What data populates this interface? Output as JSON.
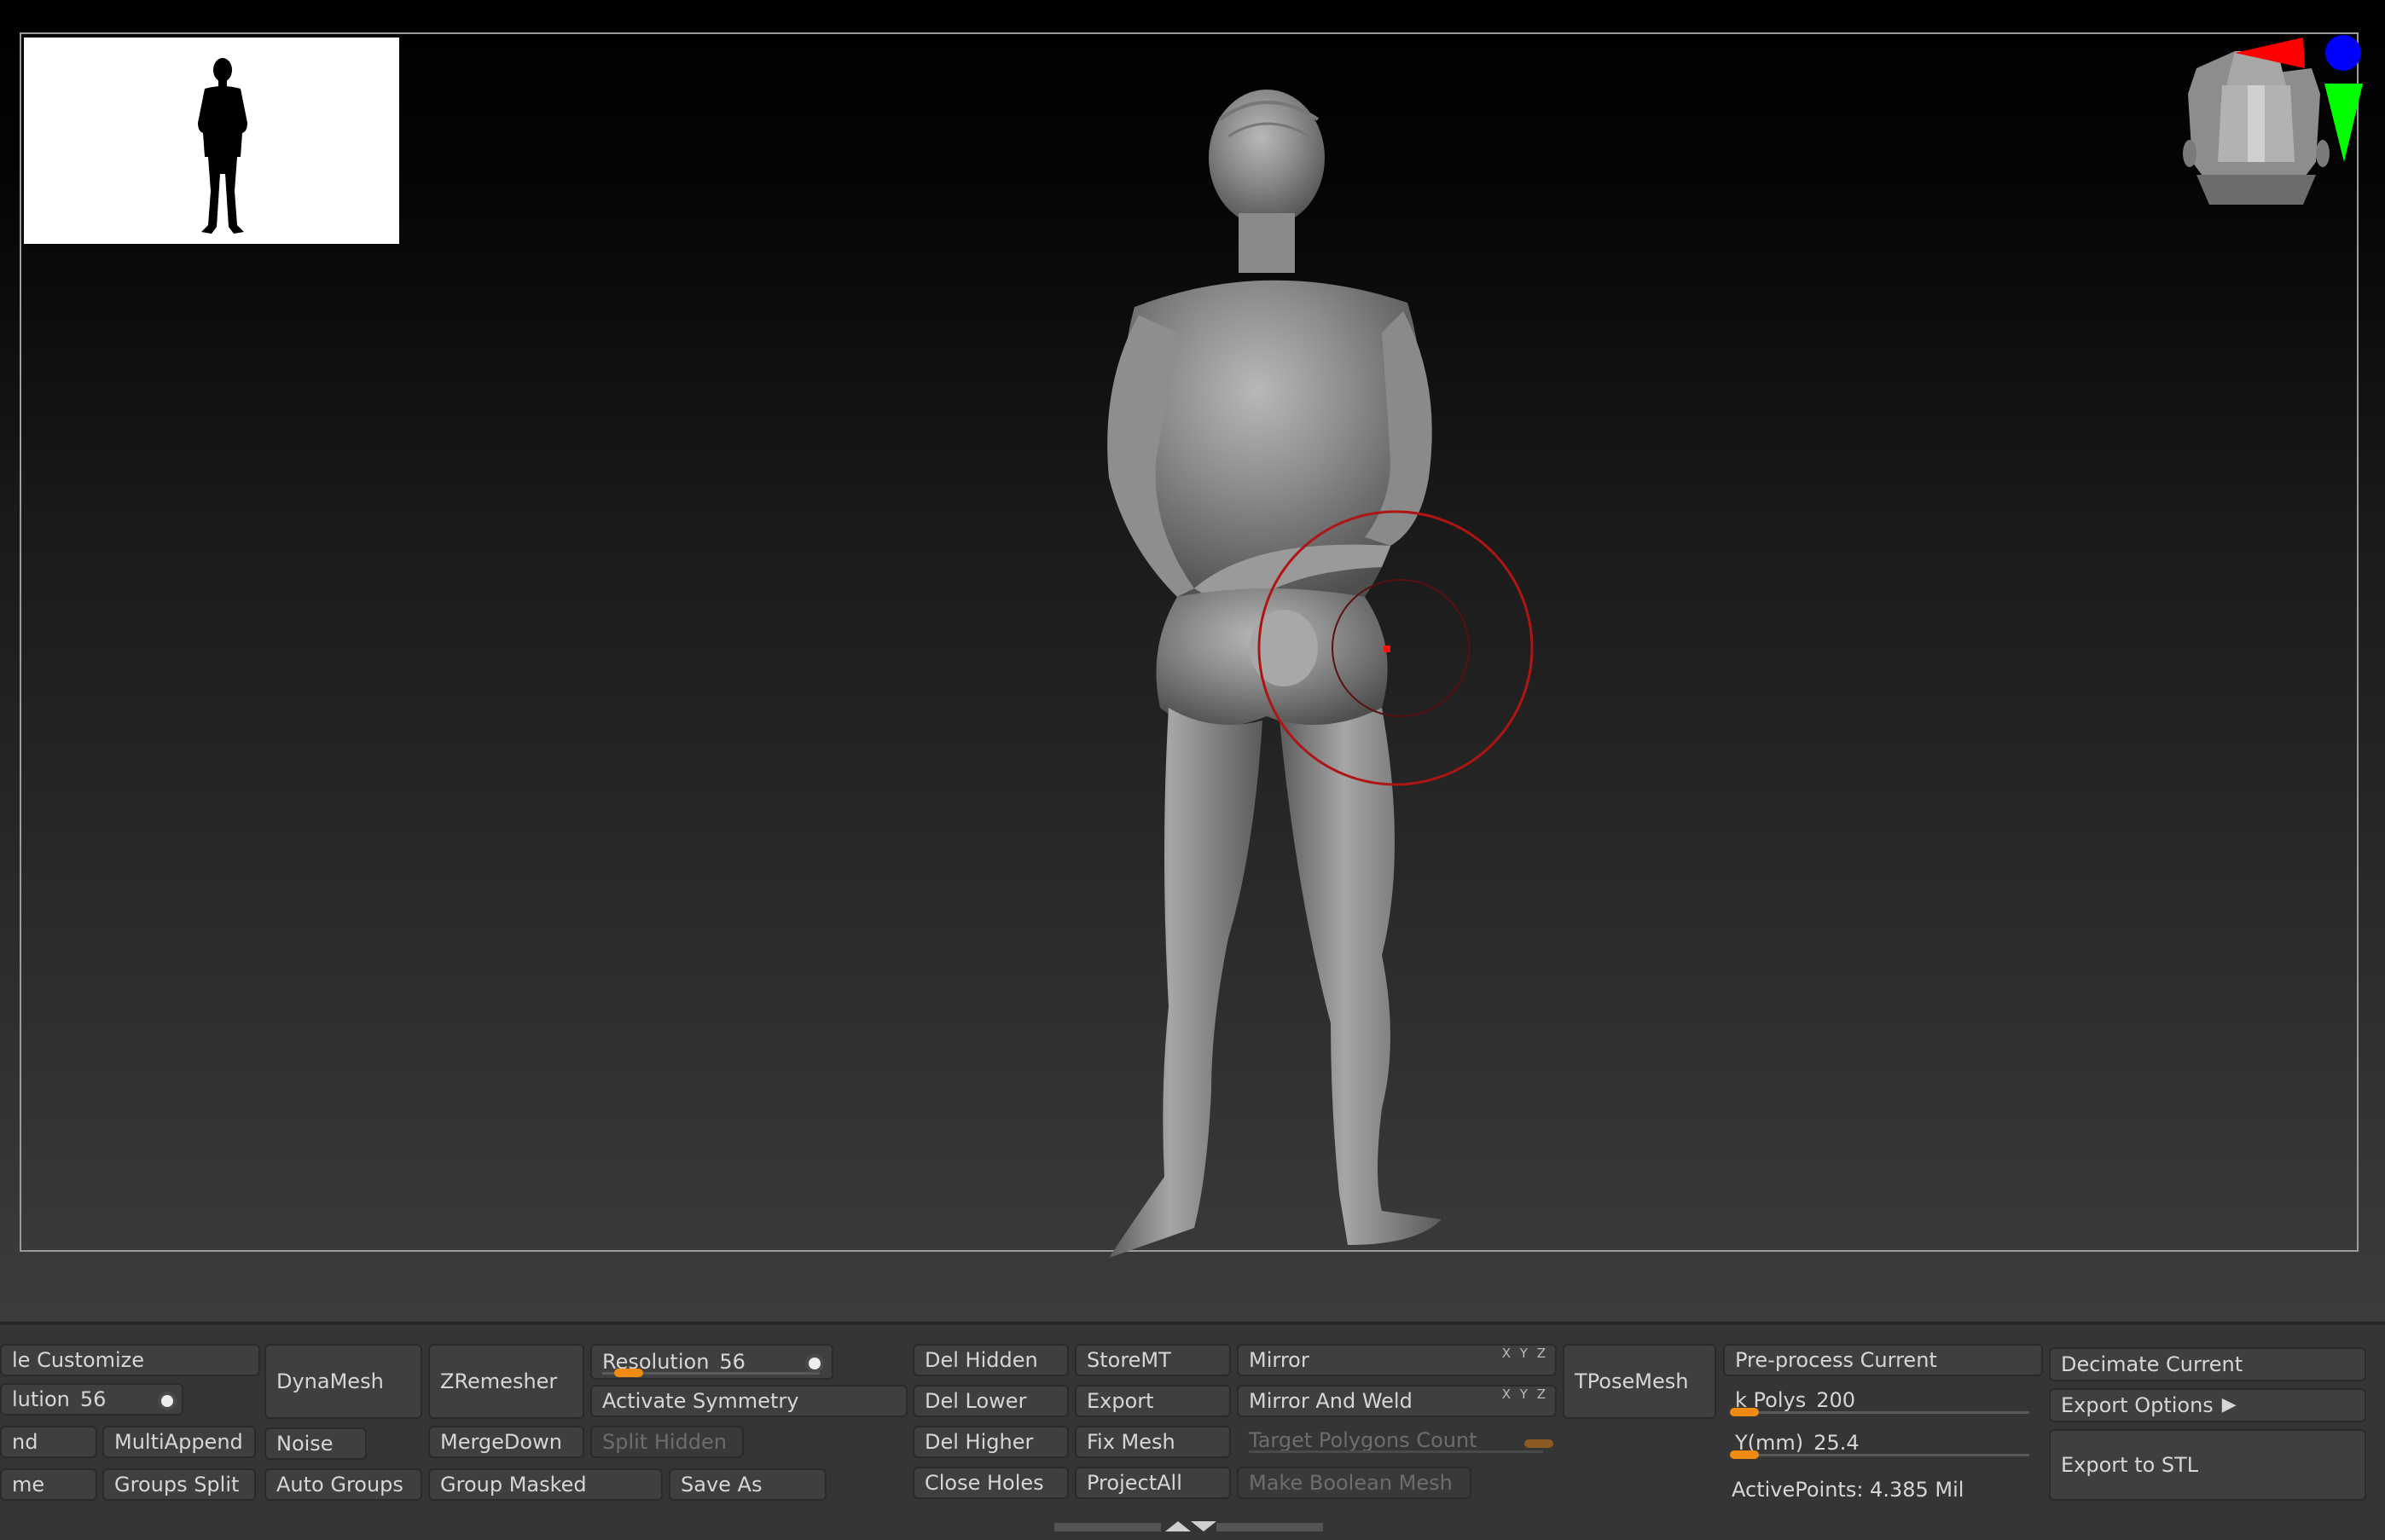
{
  "viewport": {
    "silhouette_icon": "human-silhouette-icon",
    "nav_cube_icon": "head-navigation-cube-icon",
    "axis_colors": {
      "x": "#ff0000",
      "y": "#00ff00",
      "z": "#0000ff"
    },
    "brush_color": "#cc1111"
  },
  "shelf": {
    "col1": {
      "row1": "le Customize",
      "row2_label": "lution",
      "row2_value": "56",
      "row3": "nd",
      "row4": "me"
    },
    "multiappend": "MultiAppend",
    "groups_split": "Groups Split",
    "dynamesh": "DynaMesh",
    "noise": "Noise",
    "auto_groups": "Auto Groups",
    "zremesher": "ZRemesher",
    "mergedown": "MergeDown",
    "group_masked": "Group Masked",
    "resolution_label": "Resolution",
    "resolution_value": "56",
    "activate_symmetry": "Activate Symmetry",
    "split_hidden": "Split Hidden",
    "save_as": "Save As",
    "del_hidden": "Del Hidden",
    "del_lower": "Del Lower",
    "del_higher": "Del Higher",
    "close_holes": "Close Holes",
    "storemt": "StoreMT",
    "export": "Export",
    "fix_mesh": "Fix Mesh",
    "projectall": "ProjectAll",
    "mirror": "Mirror",
    "mirror_and_weld": "Mirror And Weld",
    "target_polygons_count": "Target Polygons Count",
    "make_boolean_mesh": "Make Boolean Mesh",
    "xyz_label": "X Y Z",
    "tposemesh": "TPoseMesh",
    "preprocess_current": "Pre-process Current",
    "kpolys_label": "k Polys",
    "kpolys_value": "200",
    "ymm_label": "Y(mm)",
    "ymm_value": "25.4",
    "active_points": "ActivePoints: 4.385 Mil",
    "decimate_current": "Decimate Current",
    "export_options": "Export Options",
    "export_to_stl": "Export to STL"
  }
}
